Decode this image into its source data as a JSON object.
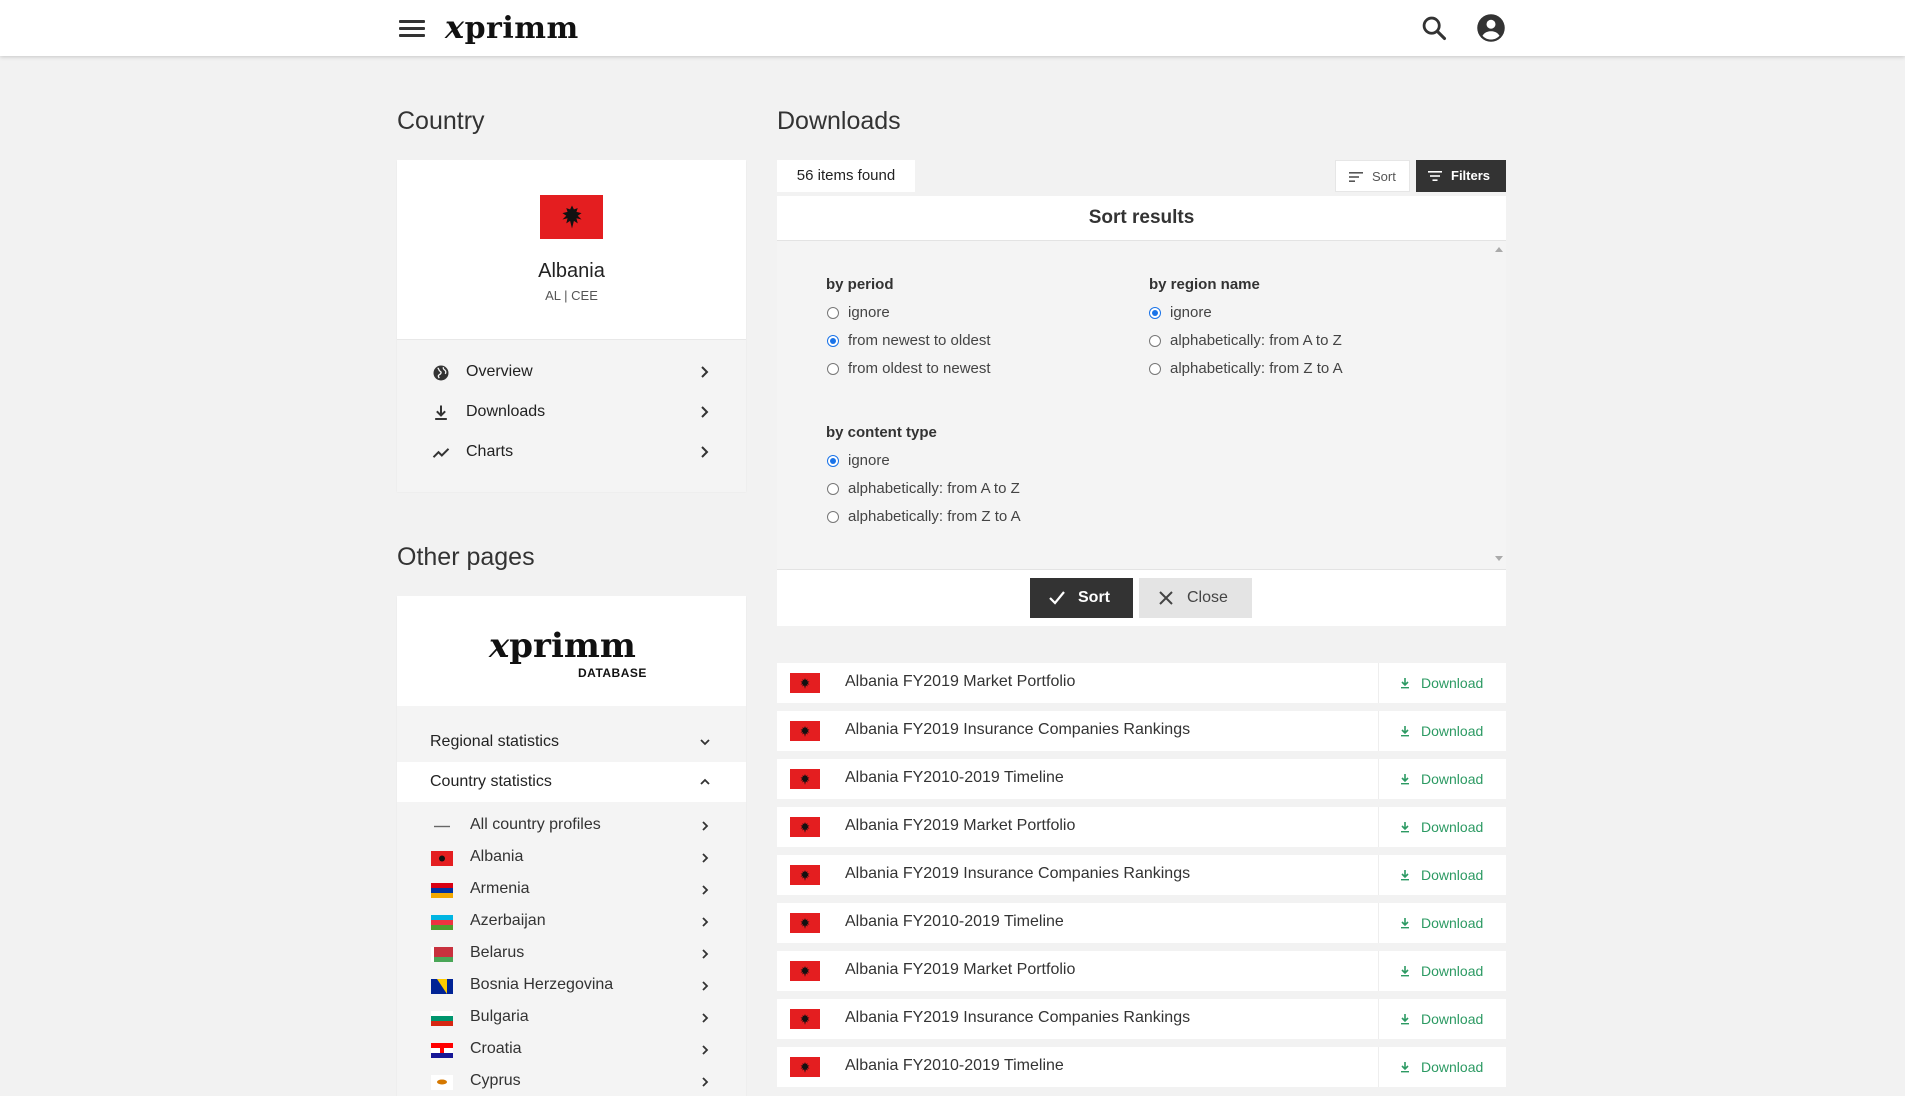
{
  "header": {
    "logo": "primm",
    "logo_x": "x"
  },
  "left": {
    "country_heading": "Country",
    "country": {
      "name": "Albania",
      "code_region": "AL | CEE"
    },
    "country_nav": [
      {
        "label": "Overview",
        "icon": "globe-icon"
      },
      {
        "label": "Downloads",
        "icon": "download-icon"
      },
      {
        "label": "Charts",
        "icon": "trending-icon"
      }
    ],
    "other_heading": "Other pages",
    "db_logo": {
      "word": "primm",
      "x": "x",
      "sub": "DATABASE"
    },
    "sections": [
      {
        "label": "Regional statistics",
        "state": "collapsed"
      },
      {
        "label": "Country statistics",
        "state": "expanded"
      }
    ],
    "country_list": [
      {
        "label": "All country profiles",
        "flag": "dash"
      },
      {
        "label": "Albania",
        "flag": "albania"
      },
      {
        "label": "Armenia",
        "flag": "armenia"
      },
      {
        "label": "Azerbaijan",
        "flag": "azerbaijan"
      },
      {
        "label": "Belarus",
        "flag": "belarus"
      },
      {
        "label": "Bosnia Herzegovina",
        "flag": "bosnia"
      },
      {
        "label": "Bulgaria",
        "flag": "bulgaria"
      },
      {
        "label": "Croatia",
        "flag": "croatia"
      },
      {
        "label": "Cyprus",
        "flag": "cyprus"
      }
    ]
  },
  "main": {
    "heading": "Downloads",
    "items_found": "56 items found",
    "sort_label": "Sort",
    "filters_label": "Filters",
    "sort_panel": {
      "title": "Sort results",
      "groups": [
        {
          "title": "by period",
          "options": [
            "ignore",
            "from newest to oldest",
            "from oldest to newest"
          ],
          "selected": 1
        },
        {
          "title": "by region name",
          "options": [
            "ignore",
            "alphabetically: from A to Z",
            "alphabetically: from Z to A"
          ],
          "selected": 0
        },
        {
          "title": "by content type",
          "options": [
            "ignore",
            "alphabetically: from A to Z",
            "alphabetically: from Z to A"
          ],
          "selected": 0
        }
      ],
      "apply_label": "Sort",
      "close_label": "Close"
    },
    "download_label": "Download",
    "downloads": [
      "Albania FY2019 Market Portfolio",
      "Albania FY2019 Insurance Companies Rankings",
      "Albania FY2010-2019 Timeline",
      "Albania FY2019 Market Portfolio",
      "Albania FY2019 Insurance Companies Rankings",
      "Albania FY2010-2019 Timeline",
      "Albania FY2019 Market Portfolio",
      "Albania FY2019 Insurance Companies Rankings",
      "Albania FY2010-2019 Timeline"
    ]
  },
  "colors": {
    "accent_dark": "#333333",
    "download_green": "#2c9a63",
    "radio_blue": "#1a73e8",
    "albania_red": "#e41e20"
  }
}
